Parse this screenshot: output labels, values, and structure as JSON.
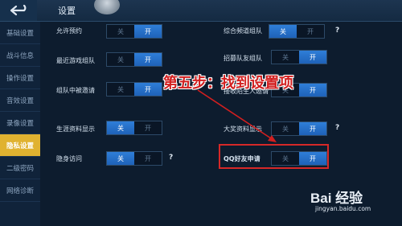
{
  "header": {
    "title": "设置",
    "back_icon": "back-arrow-icon"
  },
  "sidebar": {
    "items": [
      {
        "label": "基础设置",
        "active": false
      },
      {
        "label": "战斗信息",
        "active": false
      },
      {
        "label": "操作设置",
        "active": false
      },
      {
        "label": "音效设置",
        "active": false
      },
      {
        "label": "录像设置",
        "active": false
      },
      {
        "label": "隐私设置",
        "active": true
      },
      {
        "label": "二级密码",
        "active": false
      },
      {
        "label": "网络诊断",
        "active": false
      }
    ]
  },
  "toggle": {
    "off_label": "关",
    "on_label": "开"
  },
  "help_mark": "?",
  "settings": [
    {
      "label": "允许预约",
      "state": "on"
    },
    {
      "label": "综合频道组队",
      "state": "off"
    },
    {
      "label": "最近游戏组队",
      "state": "on"
    },
    {
      "label": "招募队友组队",
      "state": "on"
    },
    {
      "label": "组队中被邀请",
      "state": "on"
    },
    {
      "label": "接收陌生人邀请",
      "state": "on"
    },
    {
      "label": "生涯资料显示",
      "state": "off"
    },
    {
      "label": "大奖资料显示",
      "state": "on"
    },
    {
      "label": "隐身访问",
      "state": "off"
    },
    {
      "label": "QQ好友申请",
      "state": "on"
    }
  ],
  "annotation": {
    "text": "第五步：找到设置项"
  },
  "watermark": {
    "brand": "Bai 经验",
    "url": "jingyan.baidu.com"
  },
  "colors": {
    "accent": "#2f7ed8",
    "active_tab": "#e0b230",
    "highlight": "#d62828"
  }
}
